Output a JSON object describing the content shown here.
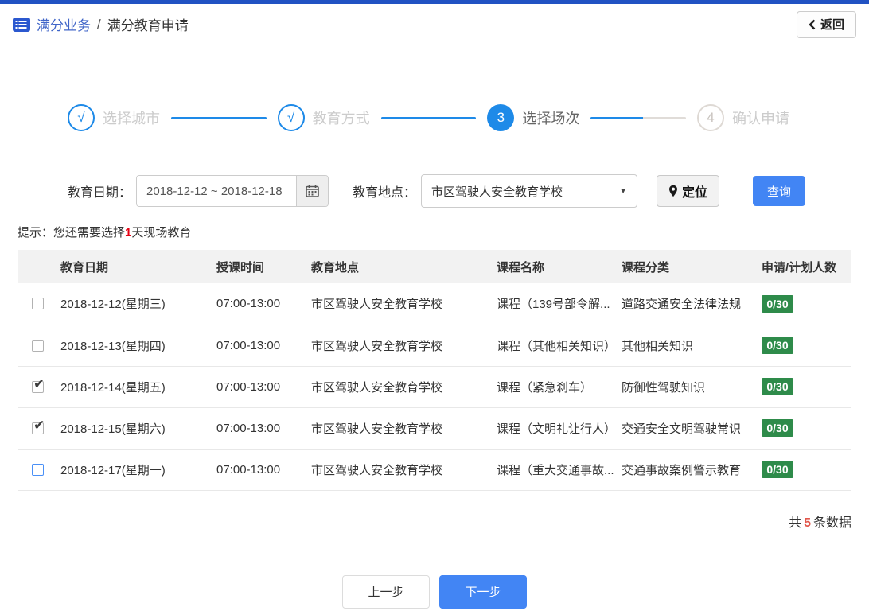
{
  "header": {
    "section": "满分业务",
    "separator": "/",
    "page": "满分教育申请",
    "back_label": "返回"
  },
  "stepper": {
    "steps": [
      {
        "marker": "√",
        "label": "选择城市",
        "state": "done"
      },
      {
        "marker": "√",
        "label": "教育方式",
        "state": "done"
      },
      {
        "marker": "3",
        "label": "选择场次",
        "state": "active"
      },
      {
        "marker": "4",
        "label": "确认申请",
        "state": "pending"
      }
    ],
    "connectors": [
      "full",
      "full",
      "half"
    ]
  },
  "filters": {
    "date_label": "教育日期：",
    "date_value": "2018-12-12 ~ 2018-12-18",
    "location_label": "教育地点：",
    "location_value": "市区驾驶人安全教育学校",
    "locate_label": "定位",
    "search_label": "查询"
  },
  "hint": {
    "prefix": "提示：您还需要选择",
    "highlight": "1",
    "suffix": "天现场教育"
  },
  "table": {
    "columns": [
      "教育日期",
      "授课时间",
      "教育地点",
      "课程名称",
      "课程分类",
      "申请/计划人数"
    ],
    "rows": [
      {
        "checkbox": "unchecked",
        "date": "2018-12-12(星期三)",
        "time": "07:00-13:00",
        "location": "市区驾驶人安全教育学校",
        "course": "课程（139号部令解...",
        "category": "道路交通安全法律法规",
        "count": "0/30"
      },
      {
        "checkbox": "unchecked",
        "date": "2018-12-13(星期四)",
        "time": "07:00-13:00",
        "location": "市区驾驶人安全教育学校",
        "course": "课程（其他相关知识）",
        "category": "其他相关知识",
        "count": "0/30"
      },
      {
        "checkbox": "checked",
        "date": "2018-12-14(星期五)",
        "time": "07:00-13:00",
        "location": "市区驾驶人安全教育学校",
        "course": "课程（紧急刹车）",
        "category": "防御性驾驶知识",
        "count": "0/30"
      },
      {
        "checkbox": "checked",
        "date": "2018-12-15(星期六)",
        "time": "07:00-13:00",
        "location": "市区驾驶人安全教育学校",
        "course": "课程（文明礼让行人）",
        "category": "交通安全文明驾驶常识",
        "count": "0/30"
      },
      {
        "checkbox": "focus",
        "date": "2018-12-17(星期一)",
        "time": "07:00-13:00",
        "location": "市区驾驶人安全教育学校",
        "course": "课程（重大交通事故...",
        "category": "交通事故案例警示教育",
        "count": "0/30"
      }
    ],
    "summary_prefix": "共",
    "summary_count": "5",
    "summary_suffix": "条数据"
  },
  "footer": {
    "prev_label": "上一步",
    "next_label": "下一步"
  },
  "icons": {
    "breadcrumb": "list-icon",
    "back": "chevron-left-icon",
    "date": "calendar-icon",
    "location_select": "caret-down-icon",
    "locate": "location-pin-icon"
  },
  "colors": {
    "top_strip": "#2152c3",
    "brand_blue": "#4065c8",
    "stepper_blue": "#1e8ae8",
    "button_blue": "#4285f4",
    "badge_green": "#2e8b4a",
    "hint_red": "#e60012",
    "count_red": "#e2574c"
  }
}
